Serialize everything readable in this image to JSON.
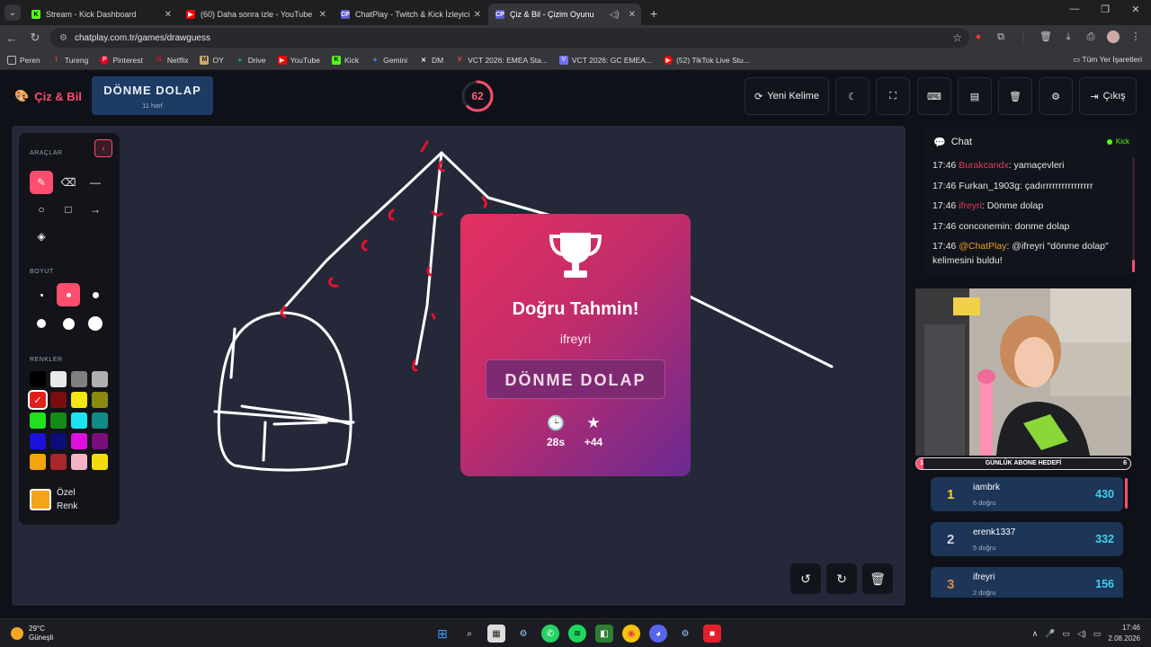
{
  "browser": {
    "tabs": [
      {
        "title": "Stream - Kick Dashboard",
        "fav": "K",
        "color": "#53fc18"
      },
      {
        "title": "(60) Daha sonra izle - YouTube",
        "fav": "▶",
        "color": "#ff0000"
      },
      {
        "title": "ChatPlay - Twitch & Kick İzleyici",
        "fav": "CP",
        "color": "#5b5bd6"
      },
      {
        "title": "Çiz & Bil - Çizim Oyunu",
        "fav": "CP",
        "color": "#5b5bd6"
      }
    ],
    "new_tab": "+",
    "url": "chatplay.com.tr/games/drawguess",
    "bookmarks": [
      {
        "label": "Peren",
        "fav": "",
        "color": "#999"
      },
      {
        "label": "Tureng",
        "fav": "t",
        "color": "#e8452b"
      },
      {
        "label": "Pinterest",
        "fav": "P",
        "color": "#e60023"
      },
      {
        "label": "Netflix",
        "fav": "N",
        "color": "#e50914"
      },
      {
        "label": "OY",
        "fav": "M",
        "color": "#caa86a"
      },
      {
        "label": "Drive",
        "fav": "▲",
        "color": "#1fa463"
      },
      {
        "label": "YouTube",
        "fav": "▶",
        "color": "#ff0000"
      },
      {
        "label": "Kick",
        "fav": "K",
        "color": "#53fc18"
      },
      {
        "label": "Gemini",
        "fav": "✦",
        "color": "#4a7ff0"
      },
      {
        "label": "DM",
        "fav": "✕",
        "color": "#333"
      },
      {
        "label": "VCT 2026: EMEA Sta...",
        "fav": "V",
        "color": "#ff4655"
      },
      {
        "label": "VCT 2026: GC EMEA...",
        "fav": "V",
        "color": "#7070ff"
      },
      {
        "label": "(52) TikTok Live Stu...",
        "fav": "▶",
        "color": "#ff0000"
      }
    ],
    "bookmarks_right": "Tüm Yer İşaretleri"
  },
  "app": {
    "logo": "Çiz & Bil",
    "word": "DÖNME DOLAP",
    "word_hint": "11 harf",
    "timer": "62",
    "timer_fraction": 0.62,
    "buttons": {
      "new_word": "Yeni Kelime",
      "exit": "Çıkış"
    }
  },
  "tools": {
    "section_tools": "ARAÇLAR",
    "section_size": "BOYUT",
    "section_colors": "RENKLER",
    "custom_color_line1": "Özel",
    "custom_color_line2": "Renk",
    "colors": [
      "#000000",
      "#e8e8e8",
      "#808080",
      "#b0b0b0",
      "#e0201c",
      "#7a0d0d",
      "#f5e614",
      "#8a8a10",
      "#22e01c",
      "#138a13",
      "#1ce4ee",
      "#128a86",
      "#1a12d8",
      "#0c0c7a",
      "#e00ee0",
      "#7a0e7a",
      "#f5a30c",
      "#a8262c",
      "#f2b4c4",
      "#f2dc0c"
    ],
    "selected_color_index": 4
  },
  "modal": {
    "title": "Doğru Tahmin!",
    "user": "ifreyri",
    "word": "DÖNME DOLAP",
    "time": "28s",
    "points": "+44"
  },
  "chat": {
    "title": "Chat",
    "platform": "Kick",
    "messages": [
      {
        "time": "17:46",
        "user": "Burakcandx",
        "user_color": "#e83a5e",
        "text": ": yamaçevleri"
      },
      {
        "time": "17:46",
        "user": "Furkan_1903g",
        "user_color": "#e6e6e6",
        "text": ": çadırrrrrrrrrrrrrrrr"
      },
      {
        "time": "17:46",
        "user": "ifreyri",
        "user_color": "#e83a5e",
        "text": ": Dönme dolap"
      },
      {
        "time": "17:46",
        "user": "conconemin",
        "user_color": "#e6e6e6",
        "text": ": donme dolap"
      },
      {
        "time": "17:46",
        "user": "@ChatPlay",
        "user_color": "#f0a020",
        "text": ": @ifreyri \"dönme dolap\" kelimesini buldu!"
      }
    ]
  },
  "goal": {
    "label": "GÜNLÜK ABONE HEDEFİ",
    "current": "1",
    "target": "6"
  },
  "leaderboard": [
    {
      "rank": "1",
      "name": "iambrk",
      "sub": "6 doğru",
      "score": "430",
      "rank_color": "#f5d020"
    },
    {
      "rank": "2",
      "name": "erenk1337",
      "sub": "5 doğru",
      "score": "332",
      "rank_color": "#cfd6e0"
    },
    {
      "rank": "3",
      "name": "ifreyri",
      "sub": "2 doğru",
      "score": "156",
      "rank_color": "#d8894a"
    }
  ],
  "taskbar": {
    "temp": "29°C",
    "weather": "Güneşli",
    "time": "17:46",
    "date": "2.08.2026"
  }
}
